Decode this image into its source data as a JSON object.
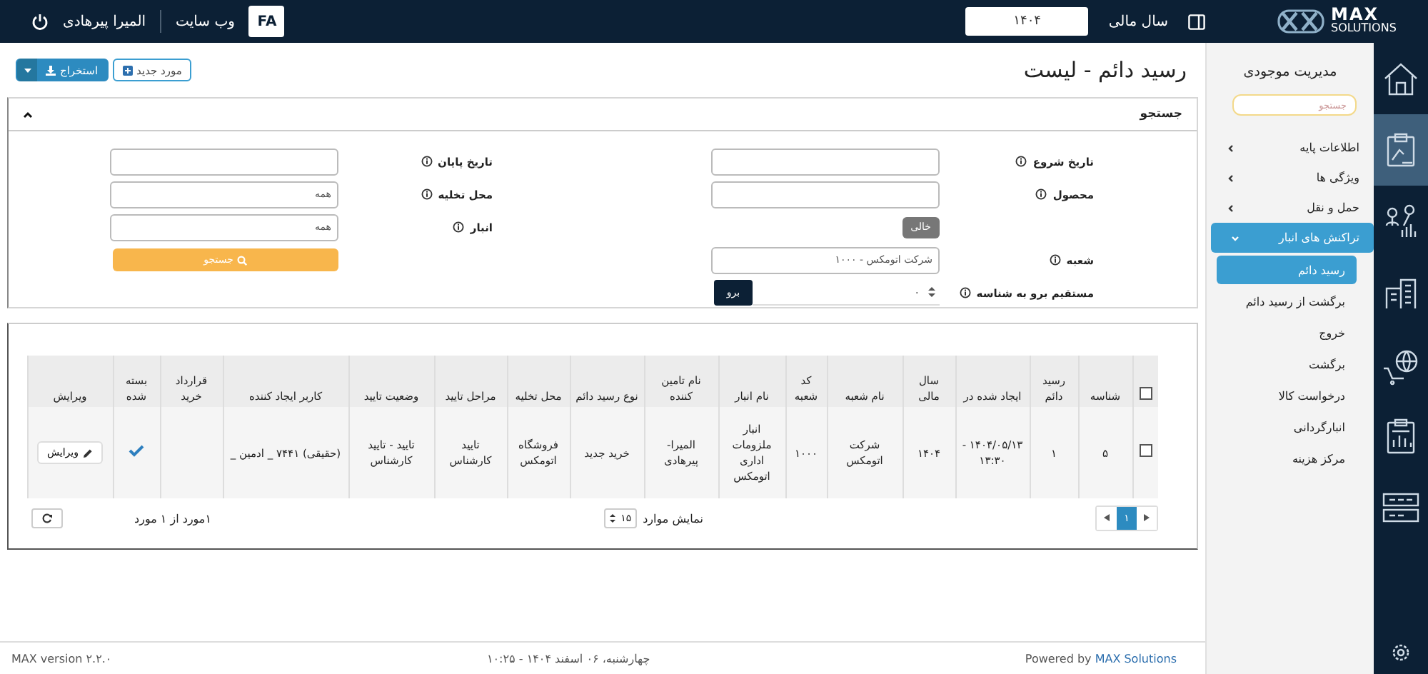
{
  "topbar": {
    "logo_top": "MAX",
    "logo_bottom": "SOLUTIONS",
    "fiscal_year_label": "سال مالی",
    "fiscal_year": "۱۴۰۴",
    "language": "FA",
    "website": "وب سایت",
    "user": "المیرا پیرهادی"
  },
  "rail": [
    {
      "kind": "home",
      "selected": false
    },
    {
      "kind": "clipboard",
      "selected": true
    },
    {
      "kind": "network",
      "selected": false
    },
    {
      "kind": "building",
      "selected": false
    },
    {
      "kind": "globe",
      "selected": false
    },
    {
      "kind": "report",
      "selected": false
    },
    {
      "kind": "screens",
      "selected": false
    }
  ],
  "sidebar": {
    "title": "مدیریت موجودی",
    "search_placeholder": "جستجو",
    "items": [
      {
        "label": "اطلاعات پایه",
        "expanded": false,
        "selected": false
      },
      {
        "label": "ویژگی ها",
        "expanded": false,
        "selected": false
      },
      {
        "label": "حمل و نقل",
        "expanded": false,
        "selected": false
      },
      {
        "label": "تراکنش های انبار",
        "expanded": true,
        "selected": true,
        "children": [
          {
            "label": "رسید دائم",
            "selected": true
          },
          {
            "label": "برگشت از رسید دائم",
            "selected": false
          },
          {
            "label": "خروج",
            "selected": false
          },
          {
            "label": "برگشت",
            "selected": false
          },
          {
            "label": "درخواست کالا",
            "selected": false
          },
          {
            "label": "انبارگردانی",
            "selected": false
          },
          {
            "label": "مرکز هزینه",
            "selected": false
          }
        ]
      }
    ]
  },
  "page": {
    "title": "رسید دائم - لیست",
    "actions": [
      {
        "kind": "add",
        "label": "مورد جدید"
      },
      {
        "kind": "dropdown",
        "label": "استخراج"
      }
    ]
  },
  "search": {
    "title": "جستجو",
    "expanded": true,
    "right_fields": [
      {
        "kind": "input",
        "label": "تاریخ شروع"
      },
      {
        "kind": "input",
        "label": "محصول"
      },
      {
        "kind": "clear",
        "label": "خالی"
      },
      {
        "kind": "input",
        "label": "شعبه",
        "value": "شرکت اتومکس - ۱۰۰۰"
      },
      {
        "kind": "goto",
        "label": "مستقیم برو به شناسه",
        "value": "۰",
        "button": "برو"
      }
    ],
    "left_fields": [
      {
        "kind": "input",
        "label": "تاریخ پایان"
      },
      {
        "kind": "input",
        "label": "محل تخلیه",
        "value": "همه"
      },
      {
        "kind": "input",
        "label": "انبار",
        "value": "همه"
      },
      {
        "kind": "search",
        "label": "جستجو"
      }
    ]
  },
  "table": {
    "all_checked": false,
    "columns": [
      "شناسه",
      "رسید دائم",
      "ایجاد شده در",
      "سال مالی",
      "نام شعبه",
      "کد شعبه",
      "نام انبار",
      "نام تامین کننده",
      "نوع رسید دائم",
      "محل تخلیه",
      "مراحل تایید",
      "وضعیت تایید",
      "کاربر ایجاد کننده",
      "قرارداد خرید",
      "بسته شده",
      "ویرایش"
    ],
    "rows": [
      {
        "checked": false,
        "cells": [
          "۵",
          "۱",
          "۱۴۰۴/۰۵/۱۳ - ۱۳:۳۰",
          "۱۴۰۴",
          "شرکت اتومکس",
          "۱۰۰۰",
          "انبار ملزومات اداری اتومکس",
          "المیرا- پیرهادی",
          "خرید جدید",
          "فروشگاه اتومکس",
          "تایید کارشناس",
          "تایید - تایید کارشناس",
          "(حقیقی) ۷۴۴۱ _ ادمین _"
        ],
        "closed": true,
        "edit": "ویرایش"
      }
    ]
  },
  "pagination": {
    "pages": [
      {
        "label": "۱",
        "selected": true
      }
    ],
    "page_size_label": "نمایش موارد",
    "page_size": "۱۵",
    "summary": "۱مورد از ۱ مورد"
  },
  "footer": {
    "version": "MAX version ۲.۲.۰",
    "datetime": "چهارشنبه، ۰۶ اسفند ۱۴۰۴ - ۱۰:۲۵",
    "powered_prefix": "Powered by",
    "powered_link": "MAX Solutions"
  }
}
